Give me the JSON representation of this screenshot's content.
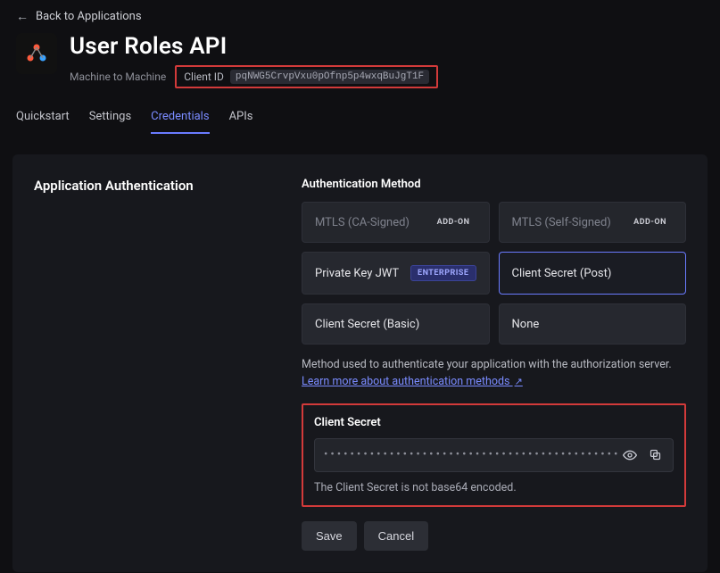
{
  "back_link": "Back to Applications",
  "app": {
    "title": "User Roles API",
    "type": "Machine to Machine",
    "client_id_label": "Client ID",
    "client_id": "pqNWG5CrvpVxu0pOfnp5p4wxqBuJgT1F"
  },
  "tabs": {
    "quickstart": "Quickstart",
    "settings": "Settings",
    "credentials": "Credentials",
    "apis": "APIs"
  },
  "panel": {
    "heading": "Application Authentication",
    "method_label": "Authentication Method",
    "methods": {
      "mtls_ca": "MTLS (CA-Signed)",
      "mtls_self": "MTLS (Self-Signed)",
      "pkjwt": "Private Key JWT",
      "cs_post": "Client Secret (Post)",
      "cs_basic": "Client Secret (Basic)",
      "none": "None"
    },
    "badges": {
      "addon": "ADD-ON",
      "enterprise": "ENTERPRISE"
    },
    "helper_text": "Method used to authenticate your application with the authorization server.",
    "helper_link": "Learn more about authentication methods",
    "secret": {
      "label": "Client Secret",
      "masked": "•••••••••••••••••••••••••••••••••••••••••••••••••",
      "note": "The Client Secret is not base64 encoded."
    },
    "buttons": {
      "save": "Save",
      "cancel": "Cancel"
    }
  }
}
